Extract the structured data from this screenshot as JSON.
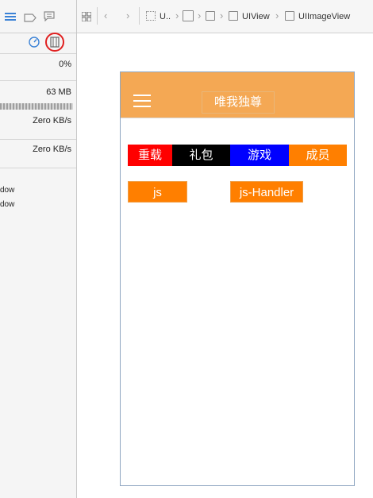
{
  "left_panel": {
    "cpu_value": "0%",
    "memory_value": "63 MB",
    "disk_value": "Zero KB/s",
    "network_value": "Zero KB/s",
    "thread_lines": [
      "dow",
      "dow"
    ]
  },
  "jump_bar": {
    "items": [
      "U..",
      "",
      "",
      "UIView",
      "UIImageView"
    ]
  },
  "app": {
    "title": "唯我独尊",
    "tabs": [
      {
        "label": "重载",
        "color": "#ff0000"
      },
      {
        "label": "礼包",
        "color": "#000000"
      },
      {
        "label": "游戏",
        "color": "#0000ff"
      },
      {
        "label": "成员",
        "color": "#ff7f00"
      }
    ],
    "buttons": [
      {
        "label": "js"
      },
      {
        "label": "js-Handler"
      }
    ]
  },
  "colors": {
    "nav_bar": "#f4a854",
    "accent_orange": "#ff7f00",
    "highlight_circle": "#e02020",
    "device_border": "#8fa6c1"
  }
}
